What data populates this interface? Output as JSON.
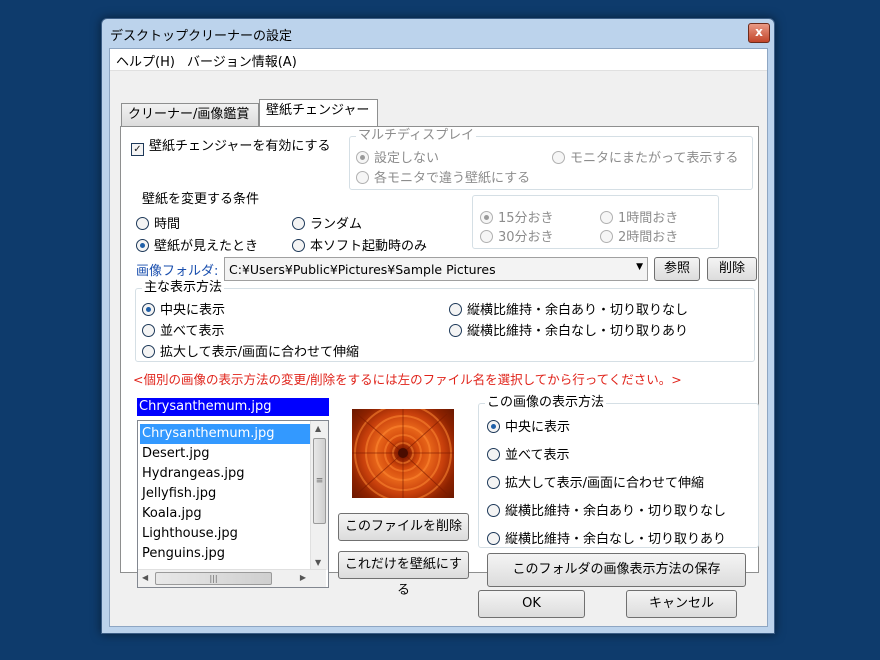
{
  "window": {
    "title": "デスクトップクリーナーの設定",
    "close_glyph": "x"
  },
  "menu": {
    "items": [
      "ヘルプ(H)",
      "バージョン情報(A)"
    ]
  },
  "tabs": [
    {
      "label": "クリーナー/画像鑑賞",
      "active": false
    },
    {
      "label": "壁紙チェンジャー",
      "active": true
    }
  ],
  "enable_checkbox": {
    "label": "壁紙チェンジャーを有効にする",
    "checked": true
  },
  "multi_display": {
    "title": "マルチディスプレイ",
    "options": [
      "設定しない",
      "モニタにまたがって表示する",
      "各モニタで違う壁紙にする"
    ],
    "selected": 0,
    "disabled": true
  },
  "change_condition": {
    "title": "壁紙を変更する条件",
    "options": [
      "時間",
      "ランダム",
      "壁紙が見えたとき",
      "本ソフト起動時のみ"
    ],
    "selected": 2
  },
  "interval": {
    "options": [
      "15分おき",
      "1時間おき",
      "30分おき",
      "2時間おき"
    ],
    "selected": 0,
    "disabled": true
  },
  "image_folder": {
    "label": "画像フォルダ:",
    "path": "C:¥Users¥Public¥Pictures¥Sample Pictures",
    "browse_label": "参照",
    "delete_label": "削除"
  },
  "display_method": {
    "title": "主な表示方法",
    "options": [
      "中央に表示",
      "縦横比維持・余白あり・切り取りなし",
      "並べて表示",
      "縦横比維持・余白なし・切り取りあり",
      "拡大して表示/画面に合わせて伸縮"
    ],
    "selected": 0
  },
  "notice": "<個別の画像の表示方法の変更/削除をするには左のファイル名を選択してから行ってください。>",
  "file_list": {
    "selected_name": "Chrysanthemum.jpg",
    "items": [
      "Chrysanthemum.jpg",
      "Desert.jpg",
      "Hydrangeas.jpg",
      "Jellyfish.jpg",
      "Koala.jpg",
      "Lighthouse.jpg",
      "Penguins.jpg"
    ],
    "selected_index": 0,
    "hscroll_grip": "|||",
    "vscroll_grip": "≡"
  },
  "preview": {
    "alt": "Chrysanthemum preview"
  },
  "file_actions": {
    "delete_label": "このファイルを削除",
    "set_wallpaper_label": "これだけを壁紙にする"
  },
  "image_method": {
    "title": "この画像の表示方法",
    "options": [
      "中央に表示",
      "並べて表示",
      "拡大して表示/画面に合わせて伸縮",
      "縦横比維持・余白あり・切り取りなし",
      "縦横比維持・余白なし・切り取りあり"
    ],
    "selected": 0
  },
  "save_folder_method_label": "このフォルダの画像表示方法の保存",
  "dialog": {
    "ok_label": "OK",
    "cancel_label": "キャンセル"
  }
}
